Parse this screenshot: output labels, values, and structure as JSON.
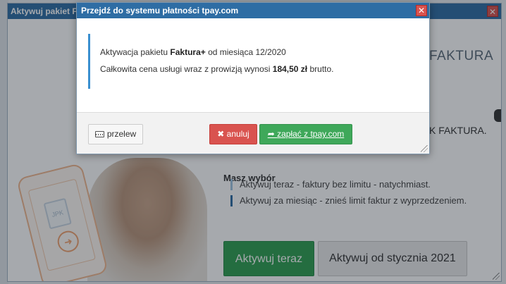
{
  "outer_dialog": {
    "title": "Aktywuj pakiet F",
    "close_glyph": "✕"
  },
  "background": {
    "brand_text": "FAKTURA",
    "side_text": "K FAKTURA.",
    "illustration_badge": "JPK",
    "choice_title": "Masz wybór",
    "choices": [
      "Aktywuj teraz - faktury bez limitu - natychmiast.",
      "Aktywuj za miesiąc - znieś limit faktur z wyprzedzeniem."
    ],
    "btn_activate_now": "Aktywuj teraz",
    "btn_activate_january": "Aktywuj od stycznia 2021"
  },
  "modal": {
    "title": "Przejdź do systemu płatności tpay.com",
    "close_glyph": "✕",
    "line1_prefix": "Aktywacja pakietu ",
    "line1_package": "Faktura+",
    "line1_suffix": " od miesiąca 12/2020",
    "line2_prefix": "Całkowita cena usługi wraz z prowizją wynosi ",
    "line2_amount": "184,50 zł",
    "line2_suffix": " brutto.",
    "btn_transfer": "przelew",
    "btn_cancel": "anuluj",
    "btn_pay": "zapłać z tpay.com"
  },
  "icons": {
    "keyboard": "keyboard-icon",
    "cancel": "times-icon",
    "pay": "share-arrow-icon"
  },
  "colors": {
    "title_bar": "#2e6da4",
    "close": "#d9534f",
    "success": "#3fa85a",
    "info_border": "#3a8fd0"
  }
}
